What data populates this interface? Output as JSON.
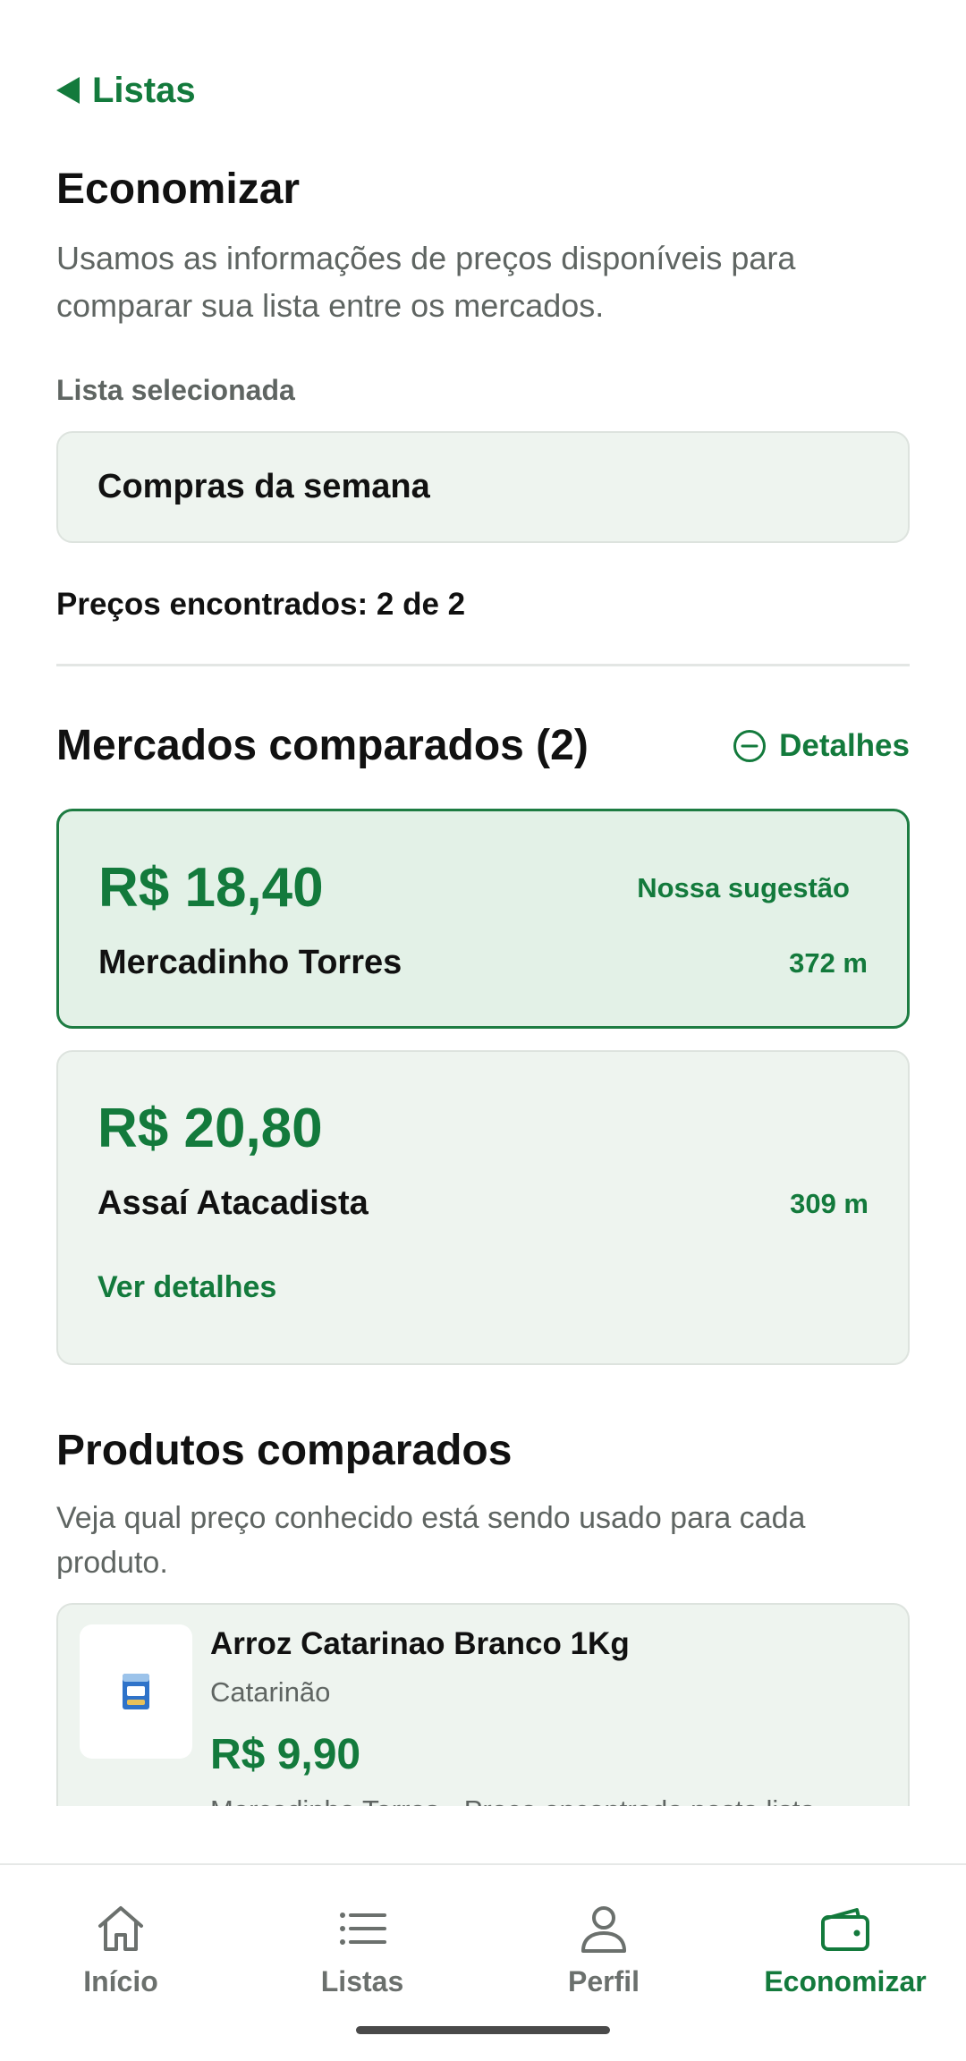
{
  "header": {
    "back_label": "Listas",
    "title": "Economizar",
    "description": "Usamos as informações de preços disponíveis para comparar sua lista entre os mercados."
  },
  "list_selector": {
    "label": "Lista selecionada",
    "value": "Compras da semana"
  },
  "prices_found": "Preços encontrados: 2 de 2",
  "markets": {
    "title": "Mercados comparados (2)",
    "details_label": "Detalhes",
    "items": [
      {
        "price": "R$ 18,40",
        "name": "Mercadinho Torres",
        "distance": "372 m",
        "badge": "Nossa sugestão"
      },
      {
        "price": "R$ 20,80",
        "name": "Assaí Atacadista",
        "distance": "309 m",
        "link": "Ver detalhes"
      }
    ]
  },
  "products": {
    "title": "Produtos comparados",
    "description": "Veja qual preço conhecido está sendo usado para cada produto.",
    "items": [
      {
        "name": "Arroz Catarinao Branco 1Kg",
        "brand": "Catarinão",
        "price": "R$ 9,90",
        "source": "Mercadinho Torres - Preço encontrado nesta lista -"
      }
    ]
  },
  "nav": {
    "items": [
      {
        "label": "Início",
        "icon": "home-icon"
      },
      {
        "label": "Listas",
        "icon": "list-icon"
      },
      {
        "label": "Perfil",
        "icon": "person-icon"
      },
      {
        "label": "Economizar",
        "icon": "wallet-icon",
        "active": true
      }
    ]
  },
  "colors": {
    "accent": "#137a3c",
    "card_bg": "#eef4ef",
    "best_card_bg": "#e3f1e7"
  }
}
